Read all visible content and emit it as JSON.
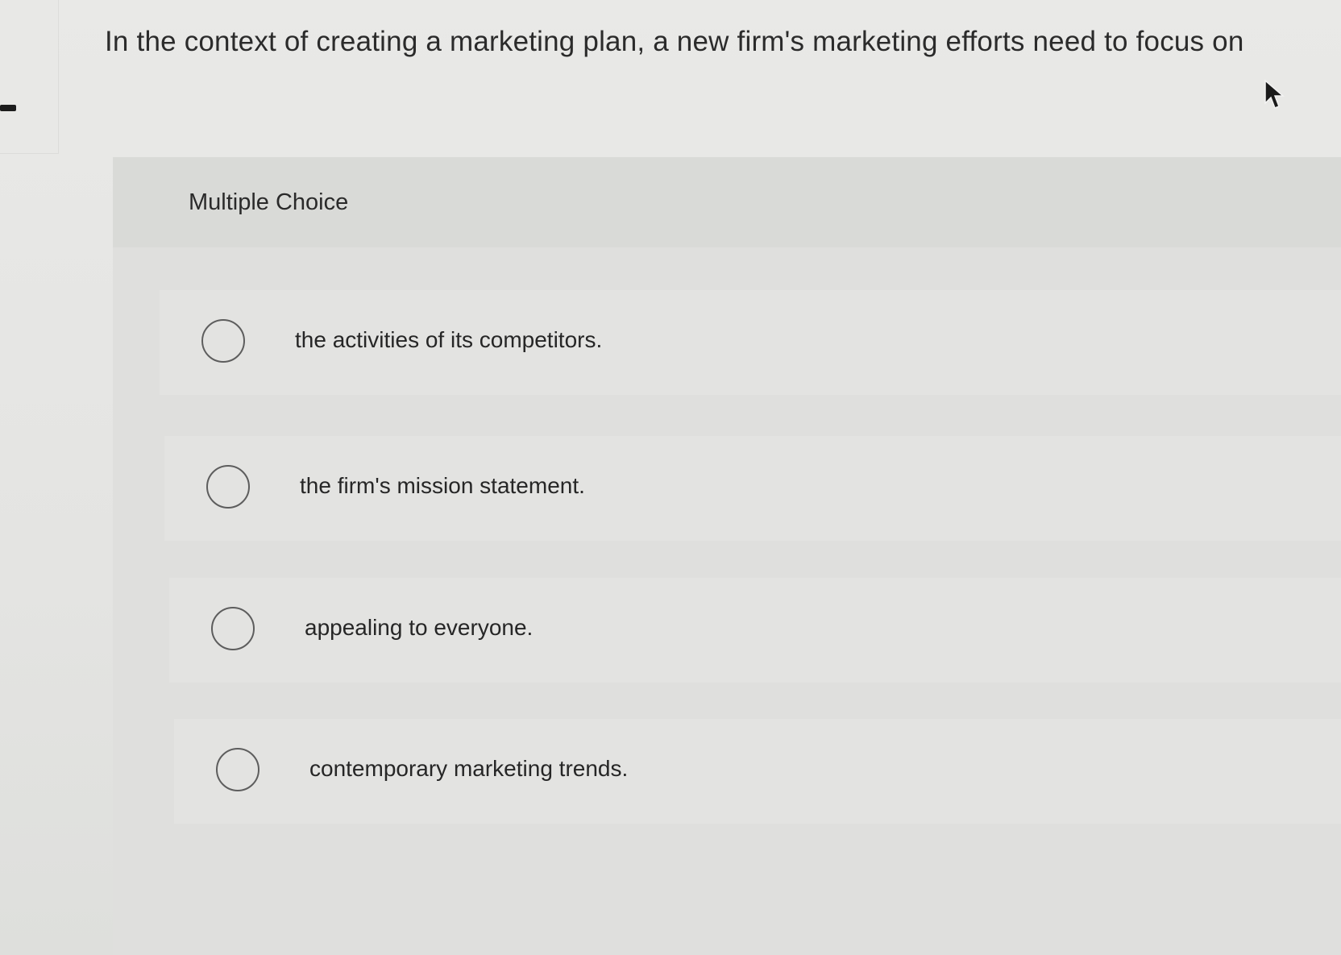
{
  "question": {
    "text": "In the context of creating a marketing plan, a new firm's marketing efforts need to focus on"
  },
  "multiple_choice": {
    "label": "Multiple Choice",
    "options": [
      {
        "text": "the activities of its competitors."
      },
      {
        "text": "the firm's mission statement."
      },
      {
        "text": "appealing to everyone."
      },
      {
        "text": "contemporary marketing trends."
      }
    ]
  },
  "icons": {
    "cursor": "mouse-pointer-icon",
    "radio": "radio-unchecked-icon"
  },
  "colors": {
    "background": "#e6e6e4",
    "panel": "#dfdfdd",
    "text": "#2a2a2a",
    "radio_border": "#5d5d5d"
  }
}
